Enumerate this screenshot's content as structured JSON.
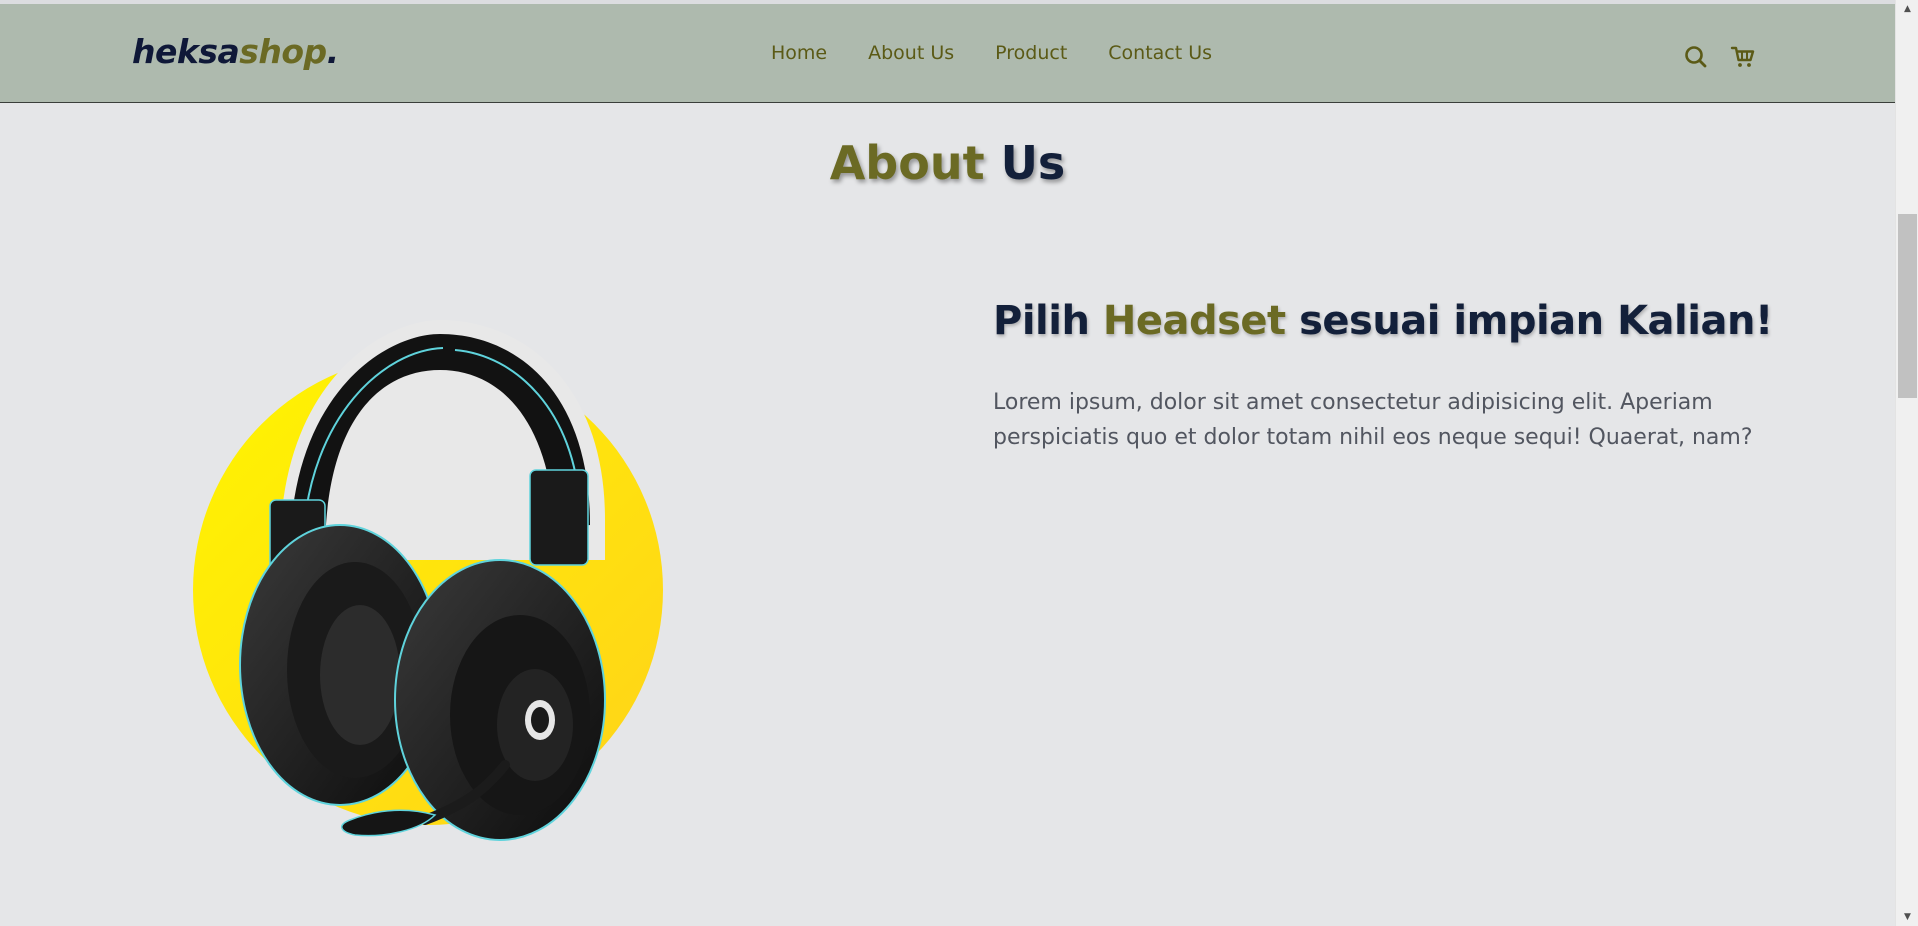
{
  "brand": {
    "part1": "heksa",
    "part2": "shop",
    "part3": "."
  },
  "nav": {
    "links": [
      "Home",
      "About Us",
      "Product",
      "Contact Us"
    ],
    "icons": [
      "search-icon",
      "cart-icon"
    ]
  },
  "section": {
    "title_part1": "About",
    "title_part2": "Us"
  },
  "about": {
    "heading_before": "Pilih ",
    "heading_highlight": "Headset",
    "heading_after": " sesuai impian Kalian!",
    "paragraph": "Lorem ipsum, dolor sit amet consectetur adipisicing elit. Aperiam perspiciatis quo et dolor totam nihil eos neque sequi! Quaerat, nam?"
  },
  "colors": {
    "navbar_bg": "#aebaae",
    "accent_olive": "#6b6a24",
    "navy": "#13203a",
    "page_bg": "#e5e6e8",
    "illustration_yellow": "#fff200"
  }
}
